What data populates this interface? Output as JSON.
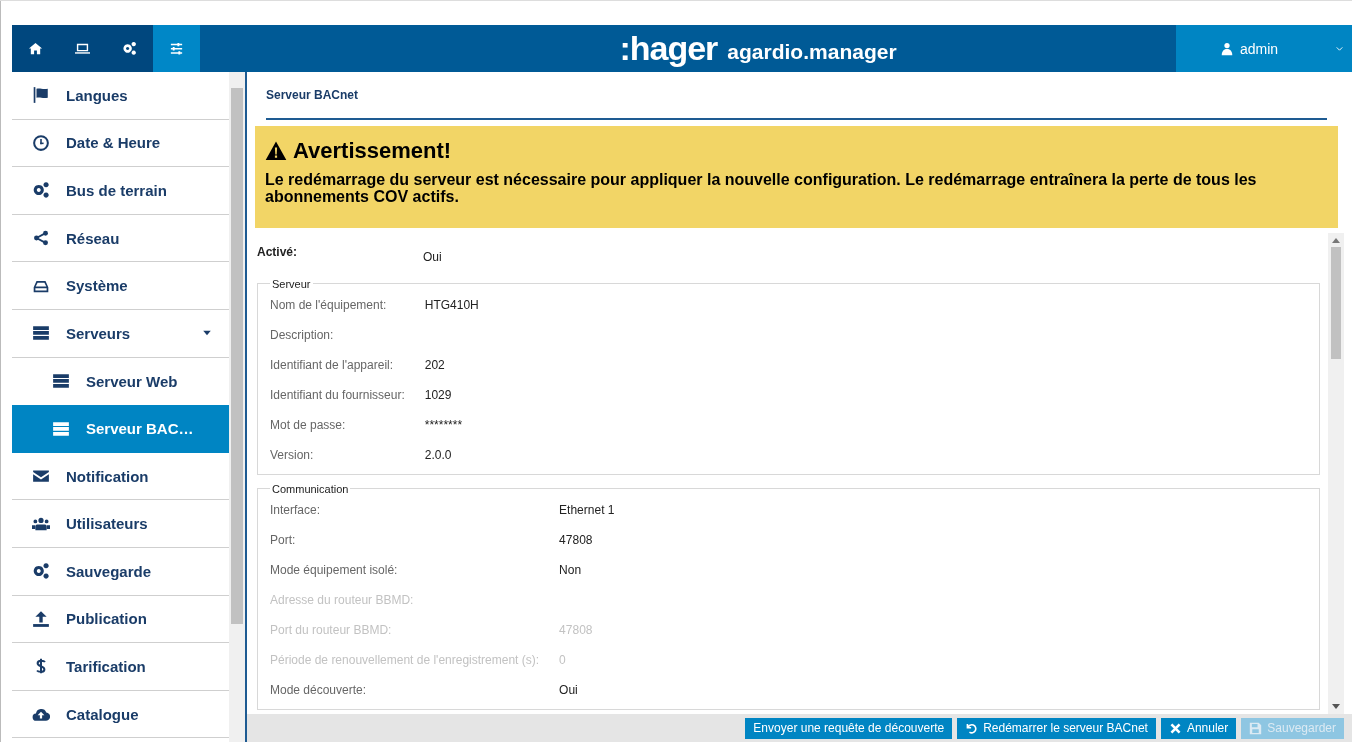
{
  "header": {
    "nav": [
      {
        "kind": "home",
        "selected": false
      },
      {
        "kind": "laptop",
        "selected": false
      },
      {
        "kind": "gears",
        "selected": false
      },
      {
        "kind": "sliders",
        "selected": true
      }
    ],
    "logo": ":hager",
    "product": "agardio.manager",
    "user": "admin"
  },
  "sidebar": {
    "items": [
      {
        "label": "Langues",
        "kind": "flag",
        "selected": false
      },
      {
        "label": "Date & Heure",
        "kind": "clock",
        "selected": false
      },
      {
        "label": "Bus de terrain",
        "kind": "gears",
        "selected": false
      },
      {
        "label": "Réseau",
        "kind": "share",
        "selected": false
      },
      {
        "label": "Système",
        "kind": "drive",
        "selected": false
      },
      {
        "label": "Serveurs",
        "kind": "server",
        "selected": false,
        "expanded": true,
        "children": [
          {
            "label": "Serveur Web",
            "kind": "server",
            "selected": false
          },
          {
            "label": "Serveur BAC…",
            "kind": "server",
            "selected": true
          }
        ]
      },
      {
        "label": "Notification",
        "kind": "envelope",
        "selected": false
      },
      {
        "label": "Utilisateurs",
        "kind": "users",
        "selected": false
      },
      {
        "label": "Sauvegarde",
        "kind": "gears",
        "selected": false
      },
      {
        "label": "Publication",
        "kind": "upload",
        "selected": false
      },
      {
        "label": "Tarification",
        "kind": "dollar",
        "selected": false
      },
      {
        "label": "Catalogue",
        "kind": "cloud",
        "selected": false
      }
    ]
  },
  "page": {
    "tab": "Serveur BACnet",
    "warning": {
      "title": "Avertissement!",
      "message": "Le redémarrage du serveur est nécessaire pour appliquer la nouvelle configuration. Le redémarrage entraînera la perte de tous les abonnements COV actifs."
    },
    "enabled": {
      "label": "Activé:",
      "value": "Oui"
    },
    "groups": [
      {
        "legend": "Serveur",
        "rows": [
          {
            "label": "Nom de l'équipement:",
            "value": "HTG410H",
            "disabled": false
          },
          {
            "label": "Description:",
            "disabled": false
          },
          {
            "label": "Identifiant de l'appareil:",
            "value": "202",
            "disabled": false
          },
          {
            "label": "Identifiant du fournisseur:",
            "value": "1029",
            "disabled": false
          },
          {
            "label": "Mot de passe:",
            "value": "********",
            "disabled": false
          },
          {
            "label": "Version:",
            "value": "2.0.0",
            "disabled": false
          }
        ]
      },
      {
        "legend": "Communication",
        "rows": [
          {
            "label": "Interface:",
            "value": "Ethernet 1",
            "disabled": false
          },
          {
            "label": "Port:",
            "value": "47808",
            "disabled": false
          },
          {
            "label": "Mode équipement isolé:",
            "value": "Non",
            "disabled": false
          },
          {
            "label": "Adresse du routeur BBMD:",
            "disabled": true
          },
          {
            "label": "Port du routeur BBMD:",
            "value": "47808",
            "disabled": true
          },
          {
            "label": "Période de renouvellement de l'enregistrement (s):",
            "value": "0",
            "disabled": true
          },
          {
            "label": "Mode découverte:",
            "value": "Oui",
            "disabled": false
          }
        ]
      }
    ]
  },
  "buttons": [
    {
      "label": "Envoyer une requête de découverte",
      "disabled": false
    },
    {
      "label": "Redémarrer le serveur BACnet",
      "kind": "undo",
      "disabled": false
    },
    {
      "label": "Annuler",
      "kind": "x",
      "disabled": false
    },
    {
      "label": "Sauvegarder",
      "kind": "save",
      "disabled": true
    }
  ]
}
